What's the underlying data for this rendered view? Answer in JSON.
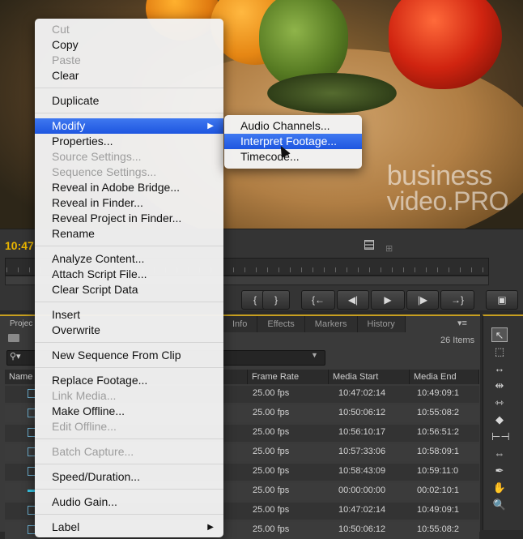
{
  "viewer": {
    "watermark_line1": "business",
    "watermark_line2": "video.PRO",
    "timecode": "10:47"
  },
  "transport": {
    "buttons": [
      "{",
      "}",
      "{←",
      "◀|",
      "▶",
      "|▶",
      "→}"
    ]
  },
  "panel": {
    "project_tab": "Projec",
    "tabs": [
      "Info",
      "Effects",
      "Markers",
      "History"
    ],
    "items_count": "26 Items",
    "columns": [
      "Name",
      "Frame Rate",
      "Media Start",
      "Media End"
    ],
    "rows": [
      {
        "frame_rate": "25.00 fps",
        "media_start": "10:47:02:14",
        "media_end": "10:49:09:1",
        "type": "clip"
      },
      {
        "frame_rate": "25.00 fps",
        "media_start": "10:50:06:12",
        "media_end": "10:55:08:2",
        "type": "clip"
      },
      {
        "frame_rate": "25.00 fps",
        "media_start": "10:56:10:17",
        "media_end": "10:56:51:2",
        "type": "clip"
      },
      {
        "frame_rate": "25.00 fps",
        "media_start": "10:57:33:06",
        "media_end": "10:58:09:1",
        "type": "clip"
      },
      {
        "frame_rate": "25.00 fps",
        "media_start": "10:58:43:09",
        "media_end": "10:59:11:0",
        "type": "clip"
      },
      {
        "frame_rate": "25.00 fps",
        "media_start": "00:00:00:00",
        "media_end": "00:02:10:1",
        "type": "sequence"
      },
      {
        "frame_rate": "25.00 fps",
        "media_start": "10:47:02:14",
        "media_end": "10:49:09:1",
        "type": "clip"
      },
      {
        "frame_rate": "25.00 fps",
        "media_start": "10:50:06:12",
        "media_end": "10:55:08:2",
        "type": "clip"
      }
    ]
  },
  "tools": [
    "selection-tool",
    "track-select-tool",
    "ripple-edit-tool",
    "rolling-edit-tool",
    "rate-stretch-tool",
    "razor-tool",
    "slip-tool",
    "slide-tool",
    "pen-tool",
    "hand-tool",
    "zoom-tool"
  ],
  "context_menu": {
    "items": [
      {
        "label": "Cut",
        "enabled": false
      },
      {
        "label": "Copy",
        "enabled": true
      },
      {
        "label": "Paste",
        "enabled": false
      },
      {
        "label": "Clear",
        "enabled": true
      },
      {
        "separator": true
      },
      {
        "label": "Duplicate",
        "enabled": true
      },
      {
        "separator": true
      },
      {
        "label": "Modify",
        "enabled": true,
        "highlighted": true,
        "submenu": true
      },
      {
        "label": "Properties...",
        "enabled": true
      },
      {
        "label": "Source Settings...",
        "enabled": false
      },
      {
        "label": "Sequence Settings...",
        "enabled": false
      },
      {
        "label": "Reveal in Adobe Bridge...",
        "enabled": true
      },
      {
        "label": "Reveal in Finder...",
        "enabled": true
      },
      {
        "label": "Reveal Project in Finder...",
        "enabled": true
      },
      {
        "label": "Rename",
        "enabled": true
      },
      {
        "separator": true
      },
      {
        "label": "Analyze Content...",
        "enabled": true
      },
      {
        "label": "Attach Script File...",
        "enabled": true
      },
      {
        "label": "Clear Script Data",
        "enabled": true
      },
      {
        "separator": true
      },
      {
        "label": "Insert",
        "enabled": true
      },
      {
        "label": "Overwrite",
        "enabled": true
      },
      {
        "separator": true
      },
      {
        "label": "New Sequence From Clip",
        "enabled": true
      },
      {
        "separator": true
      },
      {
        "label": "Replace Footage...",
        "enabled": true
      },
      {
        "label": "Link Media...",
        "enabled": false
      },
      {
        "label": "Make Offline...",
        "enabled": true
      },
      {
        "label": "Edit Offline...",
        "enabled": false
      },
      {
        "separator": true
      },
      {
        "label": "Batch Capture...",
        "enabled": false
      },
      {
        "separator": true
      },
      {
        "label": "Speed/Duration...",
        "enabled": true
      },
      {
        "separator": true
      },
      {
        "label": "Audio Gain...",
        "enabled": true
      },
      {
        "separator": true
      },
      {
        "label": "Label",
        "enabled": true,
        "submenu": true
      }
    ]
  },
  "submenu": {
    "items": [
      {
        "label": "Audio Channels...",
        "highlighted": false
      },
      {
        "label": "Interpret Footage...",
        "highlighted": true
      },
      {
        "label": "Timecode...",
        "highlighted": false
      }
    ]
  },
  "colors": {
    "highlight": "#2a62e8",
    "timecode": "#e8b400",
    "panel_accent": "#c8a020"
  }
}
